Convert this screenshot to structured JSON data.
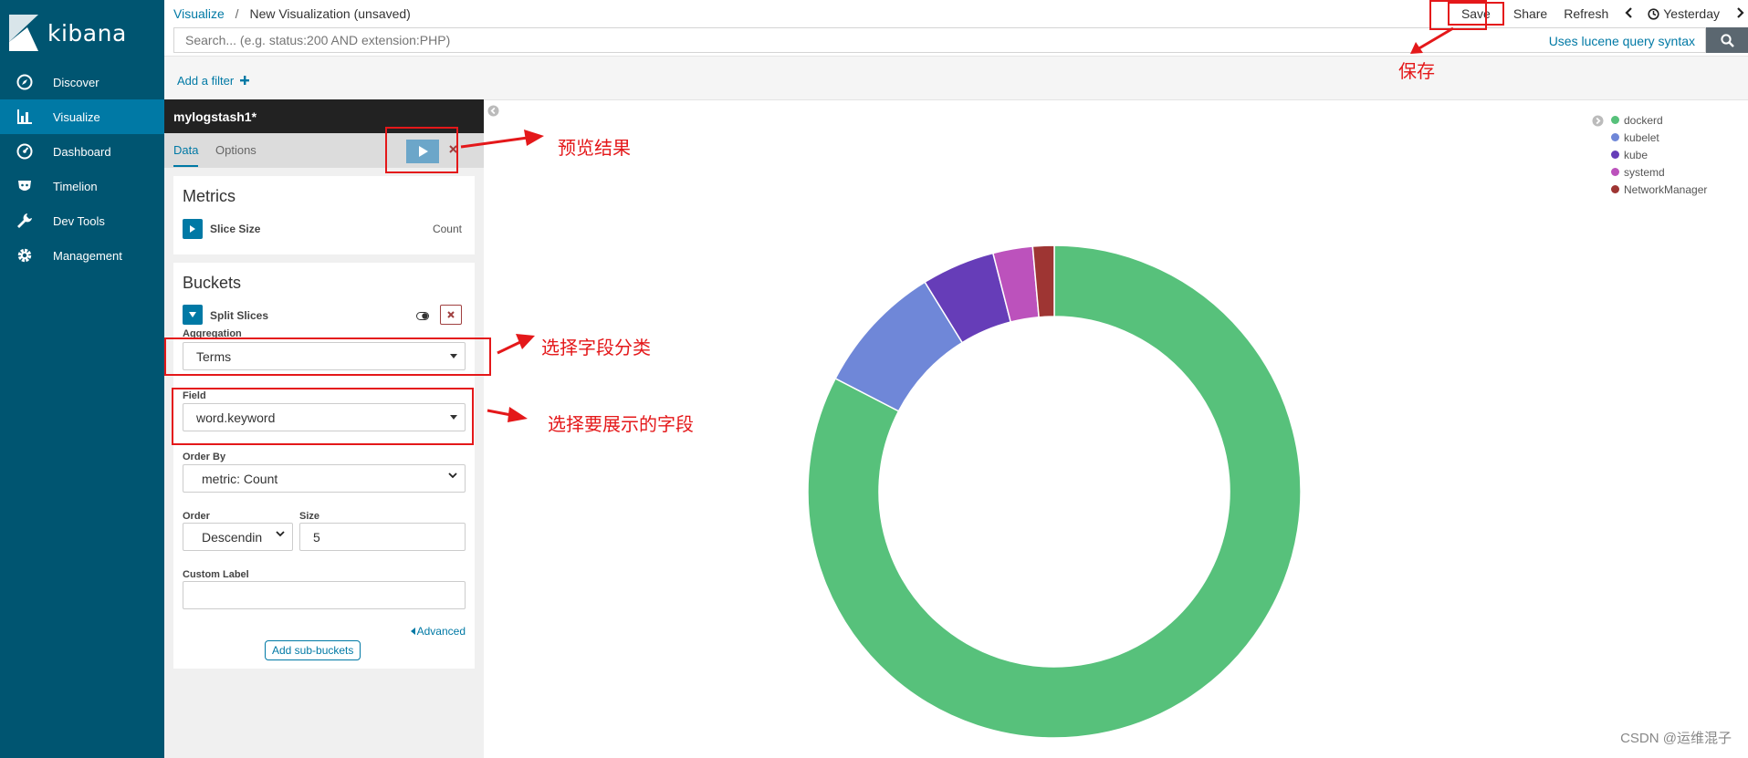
{
  "app": {
    "name": "kibana"
  },
  "sidebar": {
    "items": [
      {
        "label": "Discover",
        "icon": "compass-icon",
        "active": false
      },
      {
        "label": "Visualize",
        "icon": "bar-chart-icon",
        "active": true
      },
      {
        "label": "Dashboard",
        "icon": "dashboard-icon",
        "active": false
      },
      {
        "label": "Timelion",
        "icon": "timelion-icon",
        "active": false
      },
      {
        "label": "Dev Tools",
        "icon": "wrench-icon",
        "active": false
      },
      {
        "label": "Management",
        "icon": "gear-icon",
        "active": false
      }
    ]
  },
  "breadcrumb": {
    "parent": "Visualize",
    "separator": "/",
    "current": "New Visualization (unsaved)"
  },
  "top_actions": {
    "save": "Save",
    "share": "Share",
    "refresh": "Refresh",
    "time": "Yesterday"
  },
  "search": {
    "placeholder": "Search... (e.g. status:200 AND extension:PHP)",
    "syntax_link": "Uses lucene query syntax"
  },
  "filter": {
    "add_label": "Add a filter"
  },
  "editor": {
    "title": "mylogstash1*",
    "tabs": {
      "data": "Data",
      "options": "Options"
    },
    "metrics": {
      "heading": "Metrics",
      "item_label": "Slice Size",
      "item_value": "Count"
    },
    "buckets": {
      "heading": "Buckets",
      "item_label": "Split Slices",
      "aggregation_label": "Aggregation",
      "aggregation_value": "Terms",
      "field_label": "Field",
      "field_value": "word.keyword",
      "order_by_label": "Order By",
      "order_by_value": "metric: Count",
      "order_label": "Order",
      "order_value": "Descendin",
      "size_label": "Size",
      "size_value": "5",
      "custom_label_label": "Custom Label",
      "custom_label_value": "",
      "advanced": "Advanced",
      "add_sub": "Add sub-buckets"
    }
  },
  "annotations": {
    "save": "保存",
    "preview": "预览结果",
    "aggregation": "选择字段分类",
    "field": "选择要展示的字段"
  },
  "colors": {
    "sidebar": "#005571",
    "active": "#0079a5",
    "annotation": "#e4181a"
  },
  "chart_data": {
    "type": "pie",
    "donut": true,
    "series": [
      {
        "name": "dockerd",
        "value": 82.6,
        "color": "#57c17b"
      },
      {
        "name": "kubelet",
        "value": 8.6,
        "color": "#6f87d8"
      },
      {
        "name": "kube",
        "value": 4.8,
        "color": "#663db8"
      },
      {
        "name": "systemd",
        "value": 2.6,
        "color": "#bc52bc"
      },
      {
        "name": "NetworkManager",
        "value": 1.4,
        "color": "#9e3533"
      }
    ],
    "legend_position": "top-right"
  },
  "watermark": "CSDN @运维混子"
}
